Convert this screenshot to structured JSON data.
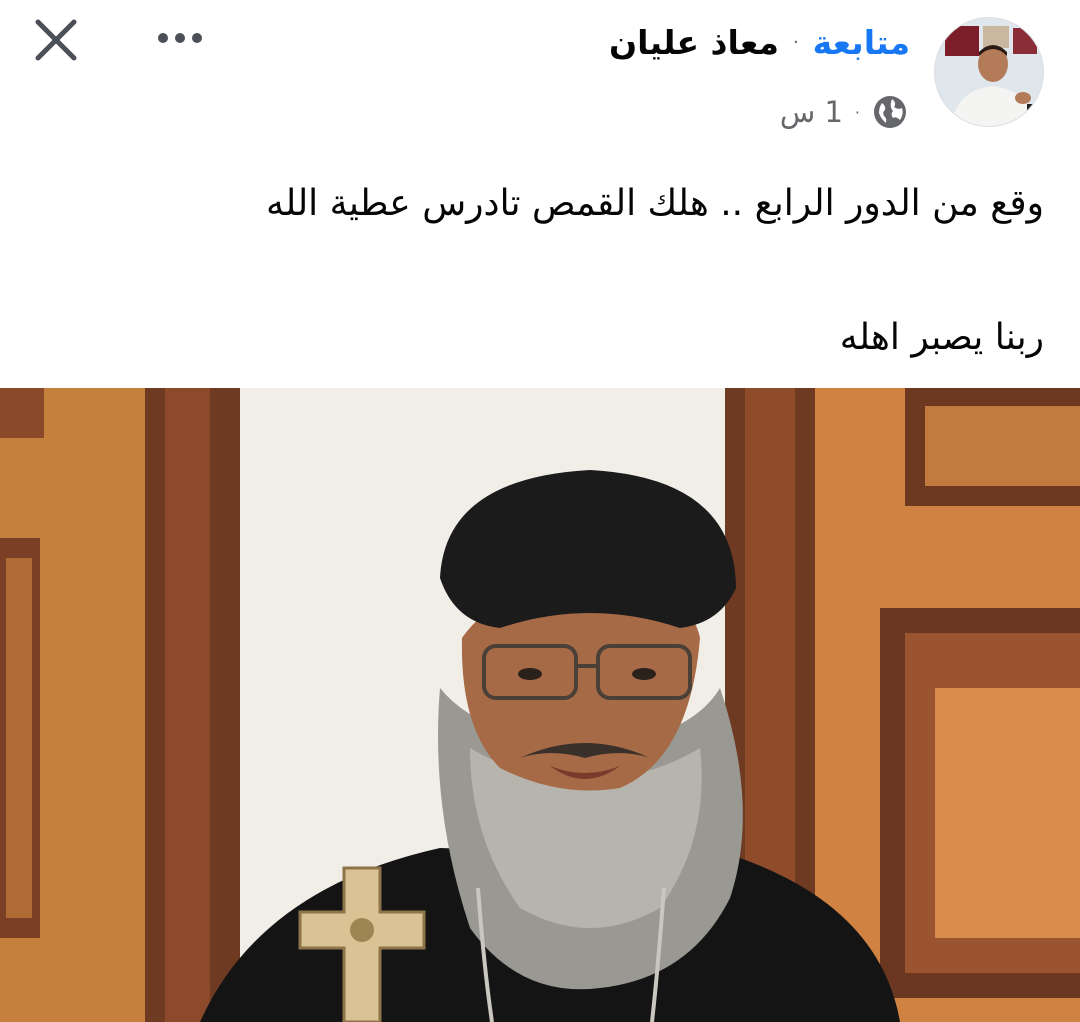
{
  "header": {
    "close_icon": "close-icon",
    "more_icon": "more-options-icon"
  },
  "author": {
    "name": "معاذ عليان",
    "separator": "·",
    "follow_label": "متابعة",
    "avatar_icon": "profile-avatar"
  },
  "meta": {
    "time": "1 س",
    "separator": "·",
    "audience_icon": "globe-icon"
  },
  "post": {
    "line1": "وقع من الدور الرابع .. هلك القمص تادرس عطية الله",
    "line2": "ربنا يصبر اهله"
  },
  "colors": {
    "follow": "#1877f2",
    "secondary_text": "#65676b",
    "wood": "#c97a3a",
    "frame": "#6b3a22",
    "robe": "#141414"
  }
}
